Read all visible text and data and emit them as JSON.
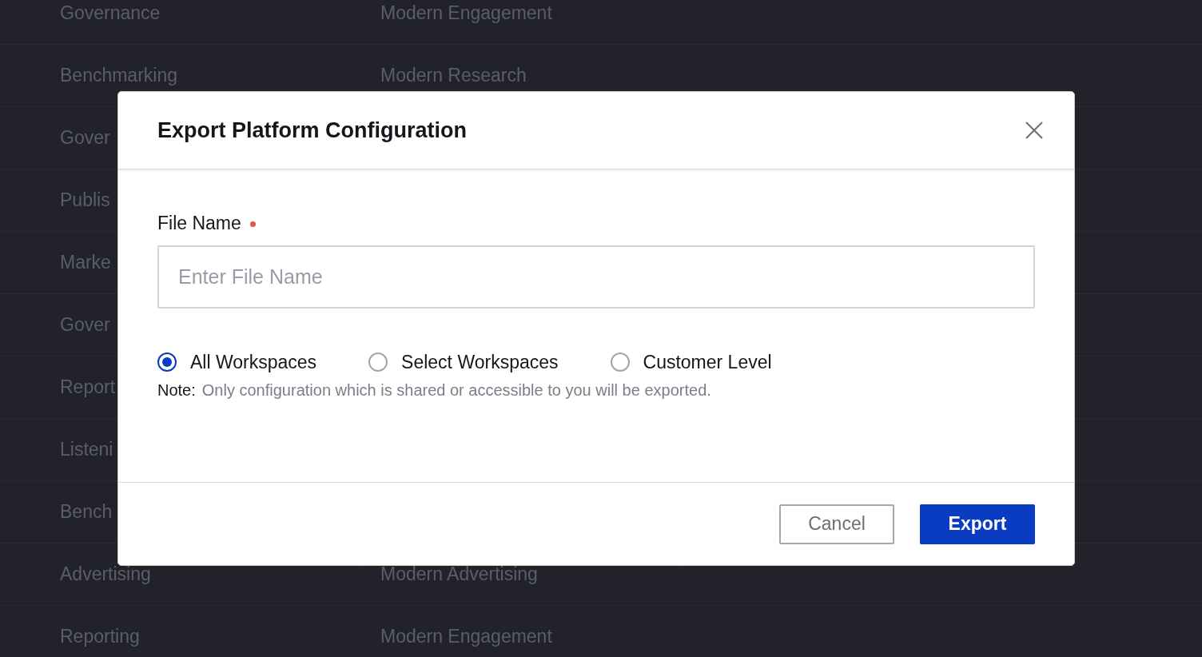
{
  "background_table": {
    "rows": [
      {
        "column_1": "Governance",
        "column_2": "Modern Engagement"
      },
      {
        "column_1": "Benchmarking",
        "column_2": "Modern Research"
      },
      {
        "column_1": "Gover"
      },
      {
        "column_1": "Publis"
      },
      {
        "column_1": "Marke"
      },
      {
        "column_1": "Gover"
      },
      {
        "column_1": "Report"
      },
      {
        "column_1": "Listeni"
      },
      {
        "column_1": "Bench"
      },
      {
        "column_1": "Advertising",
        "column_2": "Modern Advertising"
      },
      {
        "column_1": "Reporting",
        "column_2": "Modern Engagement"
      }
    ]
  },
  "dialog": {
    "title": "Export Platform Configuration",
    "file_name": {
      "label": "File Name",
      "required": true,
      "placeholder": "Enter File Name"
    },
    "scope_options": [
      {
        "label": "All Workspaces",
        "selected": true
      },
      {
        "label": "Select Workspaces",
        "selected": false
      },
      {
        "label": "Customer Level",
        "selected": false
      }
    ],
    "note": {
      "label": "Note:",
      "text": "Only configuration which is shared or accessible to you will be exported."
    },
    "buttons": [
      {
        "label": "Cancel",
        "kind": "secondary"
      },
      {
        "label": "Export",
        "kind": "primary"
      }
    ]
  }
}
